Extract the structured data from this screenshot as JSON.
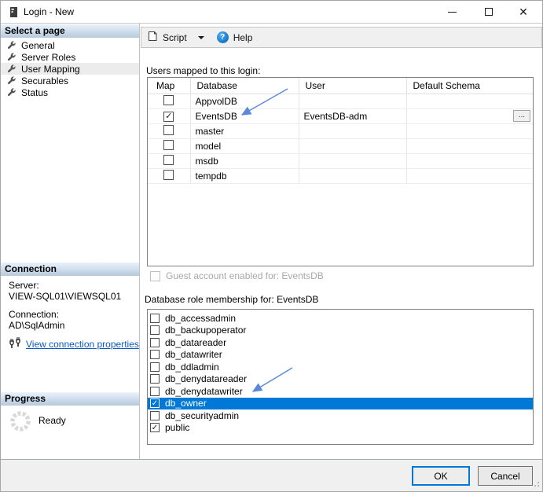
{
  "window": {
    "title": "Login - New"
  },
  "toolbar": {
    "script_label": "Script",
    "help_label": "Help",
    "help_glyph": "?"
  },
  "sidebar": {
    "pages_header": "Select a page",
    "pages": [
      {
        "label": "General",
        "selected": false
      },
      {
        "label": "Server Roles",
        "selected": false
      },
      {
        "label": "User Mapping",
        "selected": true
      },
      {
        "label": "Securables",
        "selected": false
      },
      {
        "label": "Status",
        "selected": false
      }
    ],
    "connection": {
      "header": "Connection",
      "server_label": "Server:",
      "server_value": "VIEW-SQL01\\VIEWSQL01",
      "connection_label": "Connection:",
      "connection_value": "AD\\SqlAdmin",
      "link_label": "View connection properties"
    },
    "progress": {
      "header": "Progress",
      "status": "Ready"
    }
  },
  "main": {
    "users_mapped_label": "Users mapped to this login:",
    "mapping_table": {
      "columns": [
        "Map",
        "Database",
        "User",
        "Default Schema"
      ],
      "browse_label": "...",
      "rows": [
        {
          "mapped": false,
          "database": "AppvolDB",
          "user": "",
          "default_schema": "",
          "browse": false
        },
        {
          "mapped": true,
          "database": "EventsDB",
          "user": "EventsDB-adm",
          "default_schema": "",
          "browse": true
        },
        {
          "mapped": false,
          "database": "master",
          "user": "",
          "default_schema": "",
          "browse": false
        },
        {
          "mapped": false,
          "database": "model",
          "user": "",
          "default_schema": "",
          "browse": false
        },
        {
          "mapped": false,
          "database": "msdb",
          "user": "",
          "default_schema": "",
          "browse": false
        },
        {
          "mapped": false,
          "database": "tempdb",
          "user": "",
          "default_schema": "",
          "browse": false
        }
      ]
    },
    "guest_checkbox_label": "Guest account enabled for: EventsDB",
    "roles_label": "Database role membership for: EventsDB",
    "roles": [
      {
        "name": "db_accessadmin",
        "checked": false,
        "selected": false
      },
      {
        "name": "db_backupoperator",
        "checked": false,
        "selected": false
      },
      {
        "name": "db_datareader",
        "checked": false,
        "selected": false
      },
      {
        "name": "db_datawriter",
        "checked": false,
        "selected": false
      },
      {
        "name": "db_ddladmin",
        "checked": false,
        "selected": false
      },
      {
        "name": "db_denydatareader",
        "checked": false,
        "selected": false
      },
      {
        "name": "db_denydatawriter",
        "checked": false,
        "selected": false
      },
      {
        "name": "db_owner",
        "checked": true,
        "selected": true
      },
      {
        "name": "db_securityadmin",
        "checked": false,
        "selected": false
      },
      {
        "name": "public",
        "checked": true,
        "selected": false
      }
    ]
  },
  "footer": {
    "ok_label": "OK",
    "cancel_label": "Cancel"
  },
  "colors": {
    "accent": "#0078d7",
    "selection": "#0078d7",
    "link": "#0a5bc4",
    "arrow": "#5c88d8"
  }
}
